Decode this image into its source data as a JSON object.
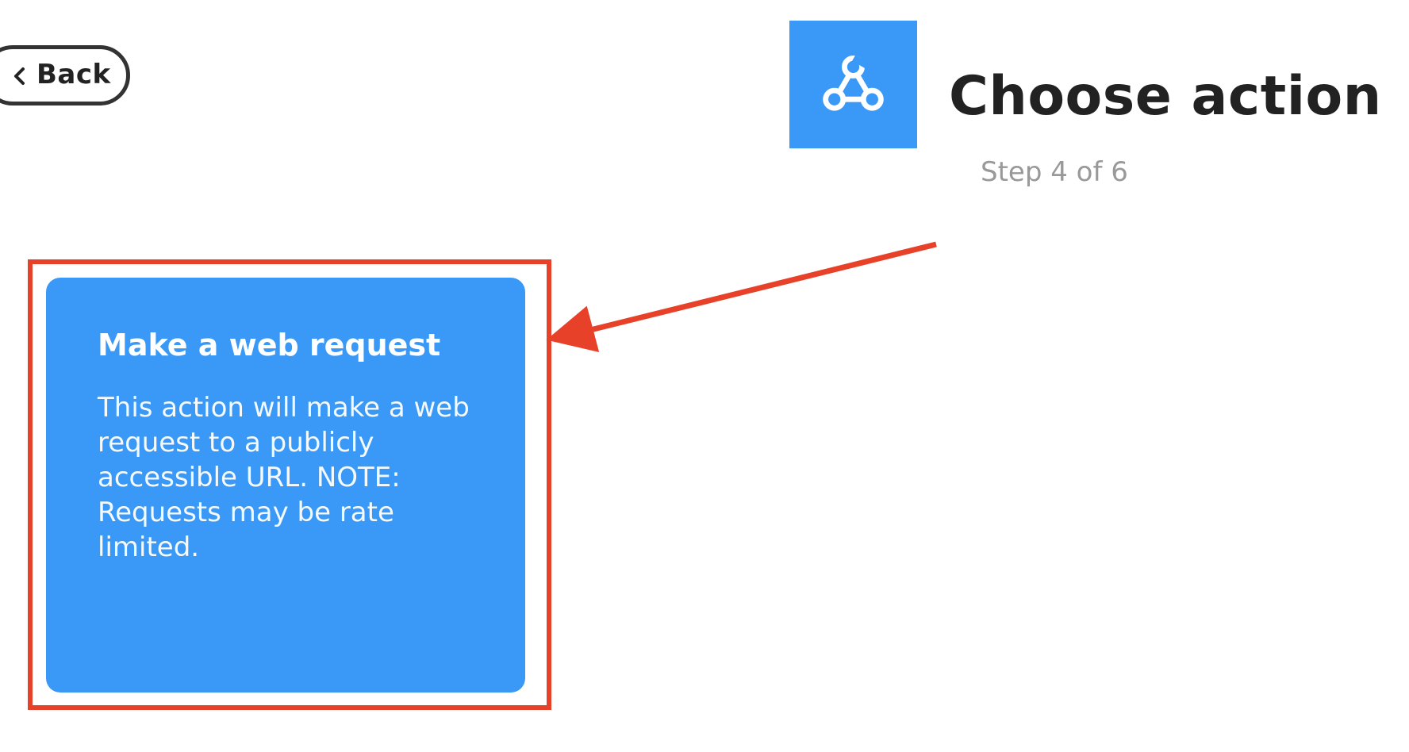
{
  "back_button": {
    "label": "Back",
    "icon": "chevron-left-icon"
  },
  "header": {
    "service_icon": "webhooks-icon",
    "title": "Choose action",
    "step": "Step 4 of 6"
  },
  "actions": [
    {
      "title": "Make a web request",
      "description": "This action will make a web request to a publicly accessible URL. NOTE: Requests may be rate limited."
    }
  ],
  "colors": {
    "accent": "#3a99f6",
    "annotation": "#e8412a",
    "title_text": "#222222",
    "muted_text": "#999999"
  }
}
